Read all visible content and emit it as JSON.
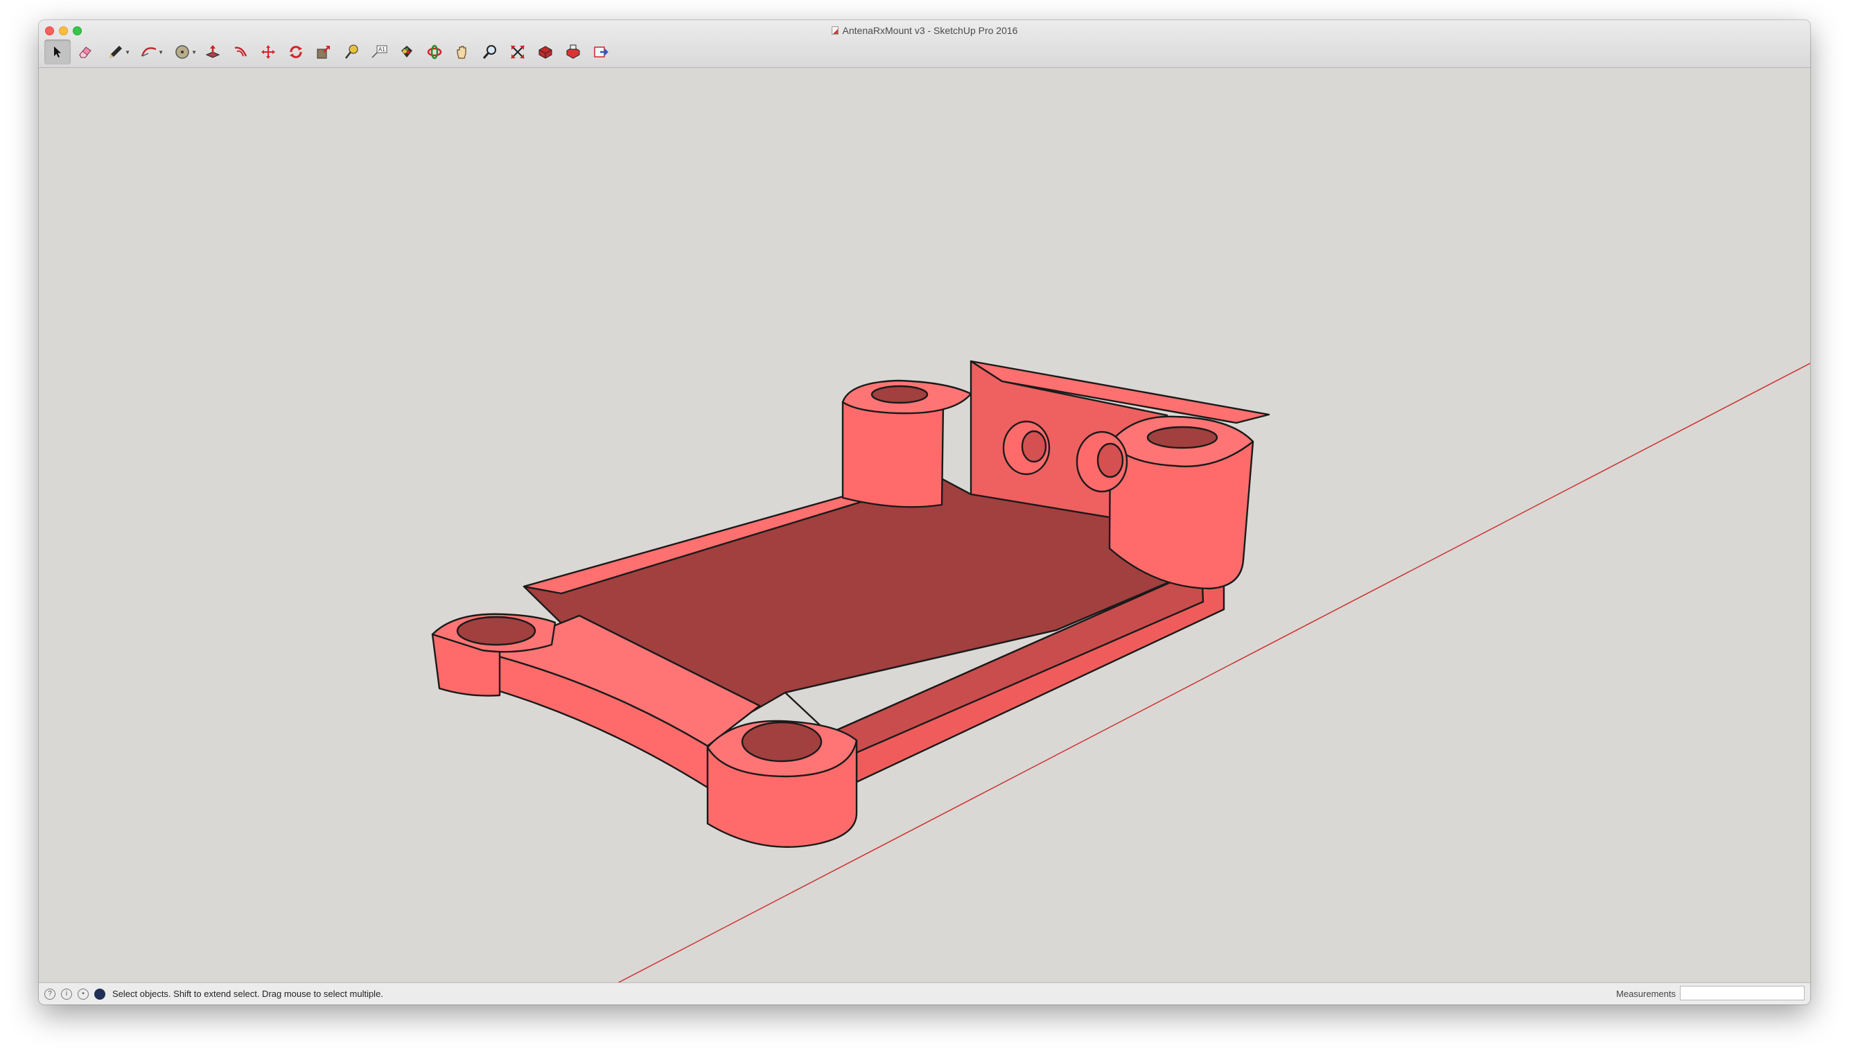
{
  "window": {
    "title": "AntenaRxMount v3 - SketchUp Pro 2016"
  },
  "toolbar": {
    "tools": [
      {
        "name": "select-tool",
        "icon": "arrow-cursor-icon",
        "active": true
      },
      {
        "name": "eraser-tool",
        "icon": "eraser-icon"
      },
      {
        "name": "line-tool",
        "icon": "pencil-icon",
        "dropdown": true
      },
      {
        "name": "arc-tool",
        "icon": "arc-icon",
        "dropdown": true
      },
      {
        "name": "shape-tool",
        "icon": "circle-shape-icon",
        "dropdown": true
      },
      {
        "name": "push-pull-tool",
        "icon": "push-pull-icon"
      },
      {
        "name": "offset-tool",
        "icon": "offset-icon"
      },
      {
        "name": "move-tool",
        "icon": "move-arrows-icon"
      },
      {
        "name": "rotate-tool",
        "icon": "rotate-icon"
      },
      {
        "name": "scale-tool",
        "icon": "scale-icon"
      },
      {
        "name": "tape-measure-tool",
        "icon": "tape-measure-icon"
      },
      {
        "name": "text-tool",
        "icon": "text-label-icon"
      },
      {
        "name": "paint-bucket-tool",
        "icon": "paint-bucket-icon"
      },
      {
        "name": "orbit-tool",
        "icon": "orbit-icon"
      },
      {
        "name": "pan-tool",
        "icon": "hand-icon"
      },
      {
        "name": "zoom-tool",
        "icon": "magnifier-icon"
      },
      {
        "name": "zoom-extents-tool",
        "icon": "zoom-extents-icon"
      },
      {
        "name": "warehouse-tool",
        "icon": "3d-warehouse-icon"
      },
      {
        "name": "extension-warehouse-tool",
        "icon": "extension-warehouse-icon"
      },
      {
        "name": "layout-send-tool",
        "icon": "send-to-layout-icon"
      }
    ],
    "text_tool_glyph": "A1"
  },
  "status": {
    "message": "Select objects. Shift to extend select. Drag mouse to select multiple.",
    "icons": [
      "info-icon",
      "credits-icon",
      "user-icon",
      "geo-location-icon"
    ],
    "measurements_label": "Measurements",
    "measurements_value": ""
  },
  "colors": {
    "model_face": "#ff6b6b",
    "model_face_light": "#ff7575",
    "model_face_shade": "#eb5a5a",
    "model_face_dark": "#a1403f",
    "model_edge": "#1a1a1a",
    "viewport_bg": "#dad8d4",
    "red_axis": "#cc3333"
  }
}
